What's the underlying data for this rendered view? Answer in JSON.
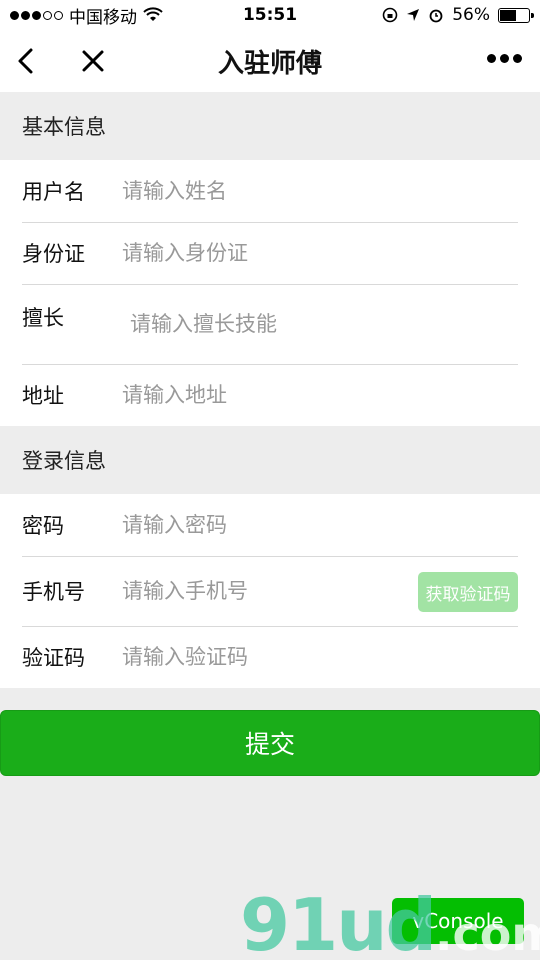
{
  "status_bar": {
    "carrier": "中国移动",
    "time": "15:51",
    "battery": "56%",
    "battery_level": 0.56
  },
  "nav": {
    "title": "入驻师傅"
  },
  "sections": {
    "basic": {
      "title": "基本信息",
      "name": {
        "label": "用户名",
        "placeholder": "请输入姓名"
      },
      "id_card": {
        "label": "身份证",
        "placeholder": "请输入身份证"
      },
      "skills": {
        "label": "擅长",
        "placeholder": "请输入擅长技能"
      },
      "address": {
        "label": "地址",
        "placeholder": "请输入地址"
      }
    },
    "login": {
      "title": "登录信息",
      "password": {
        "label": "密码",
        "placeholder": "请输入密码"
      },
      "phone": {
        "label": "手机号",
        "placeholder": "请输入手机号",
        "code_button": "获取验证码"
      },
      "code": {
        "label": "验证码",
        "placeholder": "请输入验证码"
      }
    }
  },
  "submit_label": "提交",
  "vconsole_label": "vConsole",
  "watermark": {
    "brand": "91ud",
    "suffix": ".com"
  },
  "colors": {
    "primary": "#1aad19",
    "code_button": "#a2e3a4",
    "background": "#ededed",
    "vconsole": "#04be02"
  }
}
